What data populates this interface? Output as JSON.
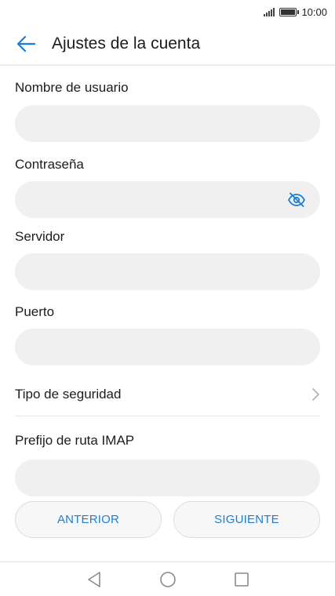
{
  "status": {
    "time": "10:00"
  },
  "header": {
    "title": "Ajustes de la cuenta"
  },
  "form": {
    "username": {
      "label": "Nombre de usuario",
      "value": ""
    },
    "password": {
      "label": "Contraseña",
      "value": ""
    },
    "server": {
      "label": "Servidor",
      "value": ""
    },
    "port": {
      "label": "Puerto",
      "value": ""
    },
    "security": {
      "label": "Tipo de seguridad"
    },
    "imap_prefix": {
      "label": "Prefijo de ruta IMAP",
      "value": ""
    }
  },
  "buttons": {
    "previous": "ANTERIOR",
    "next": "SIGUIENTE"
  },
  "colors": {
    "accent": "#1a7fd4",
    "field_bg": "#f0f0f0"
  },
  "icons": [
    "signal-icon",
    "battery-icon",
    "back-arrow-icon",
    "eye-off-icon",
    "chevron-right-icon",
    "nav-back-icon",
    "nav-home-icon",
    "nav-recents-icon"
  ]
}
